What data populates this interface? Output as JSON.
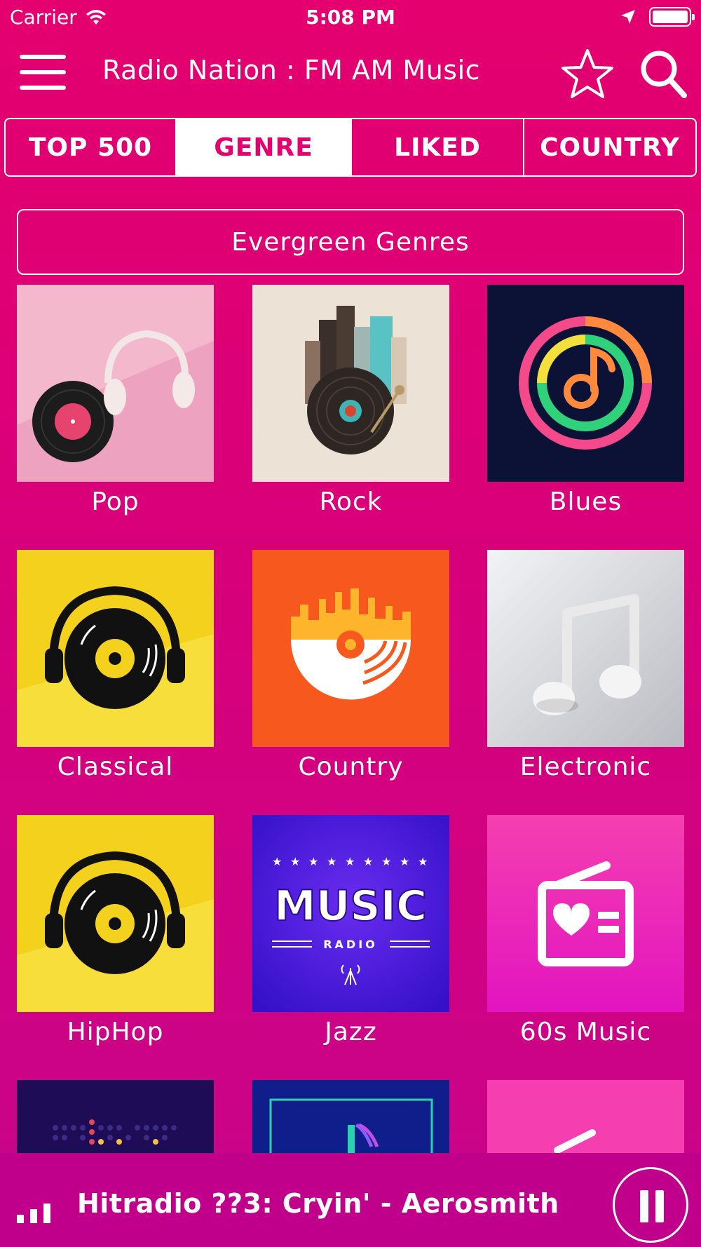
{
  "status_bar": {
    "carrier": "Carrier",
    "time": "5:08 PM"
  },
  "header": {
    "title": "Radio Nation : FM AM Music",
    "menu_icon": "hamburger-menu-icon",
    "favorite_icon": "star-icon",
    "search_icon": "search-icon"
  },
  "tabs": [
    {
      "label": "TOP 500",
      "active": false
    },
    {
      "label": "GENRE",
      "active": true
    },
    {
      "label": "LIKED",
      "active": false
    },
    {
      "label": "COUNTRY",
      "active": false
    }
  ],
  "section": {
    "title": "Evergreen Genres"
  },
  "genres": [
    {
      "label": "Pop"
    },
    {
      "label": "Rock"
    },
    {
      "label": "Blues"
    },
    {
      "label": "Classical"
    },
    {
      "label": "Country"
    },
    {
      "label": "Electronic"
    },
    {
      "label": "HipHop"
    },
    {
      "label": "Jazz"
    },
    {
      "label": "60s Music"
    }
  ],
  "jazz_art": {
    "word": "MUSIC",
    "sub": "RADIO"
  },
  "now_playing": {
    "title": "Hitradio ??3: Cryin' - Aerosmith",
    "state_icon": "pause-icon"
  },
  "colors": {
    "accent": "#e4006e",
    "background_bottom": "#c8048a",
    "player_bar": "#c0008a"
  }
}
